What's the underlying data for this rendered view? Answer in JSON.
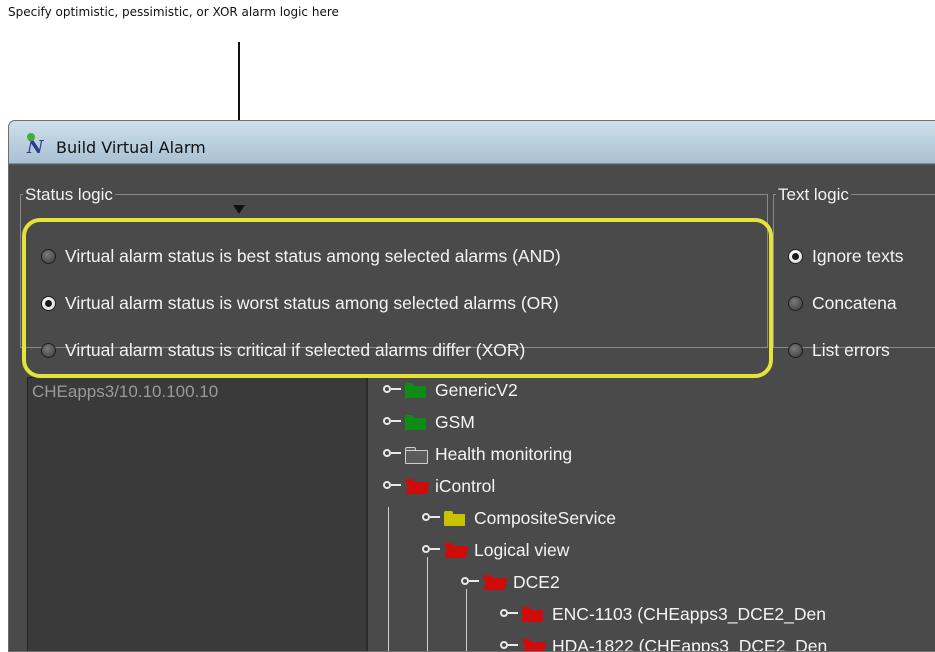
{
  "annotation": {
    "text": "Specify optimistic, pessimistic, or XOR alarm logic here"
  },
  "window": {
    "title": "Build Virtual Alarm",
    "icon": "inavigator-app-icon"
  },
  "status_logic": {
    "legend": "Status logic",
    "options": [
      {
        "label": "Virtual alarm status is best status among selected alarms (AND)",
        "selected": false
      },
      {
        "label": "Virtual alarm status is worst status among selected alarms (OR)",
        "selected": true
      },
      {
        "label": "Virtual alarm status is critical if selected alarms differ (XOR)",
        "selected": false
      }
    ]
  },
  "text_logic": {
    "legend": "Text logic",
    "options": [
      {
        "label": "Ignore texts",
        "selected": true
      },
      {
        "label": "Concatena",
        "selected": false
      },
      {
        "label": "List errors",
        "selected": false
      }
    ]
  },
  "left_list": {
    "host": "CHEapps3/10.10.100.10"
  },
  "tree": {
    "nodes": [
      {
        "label": "GenericV2",
        "folder_color": "green",
        "expanded": false
      },
      {
        "label": "GSM",
        "folder_color": "green",
        "expanded": false
      },
      {
        "label": "Health monitoring",
        "folder_color": "gray",
        "expanded": false
      },
      {
        "label": "iControl",
        "folder_color": "red",
        "expanded": true
      },
      {
        "label": "CompositeService",
        "folder_color": "yellow",
        "expanded": false
      },
      {
        "label": "Logical view",
        "folder_color": "red",
        "expanded": true
      },
      {
        "label": "DCE2",
        "folder_color": "red",
        "expanded": true
      },
      {
        "label": "ENC-1103 (CHEapps3_DCE2_Den",
        "folder_color": "red",
        "expanded": false
      },
      {
        "label": "HDA-1822 (CHEapps3_DCE2_Den",
        "folder_color": "red",
        "expanded": false
      }
    ]
  },
  "colors": {
    "highlight": "#e5e23a",
    "folder_green": "#0f8a12",
    "folder_red": "#d10a0a",
    "folder_yellow": "#c8c200",
    "folder_gray": "#5c5c5c"
  }
}
